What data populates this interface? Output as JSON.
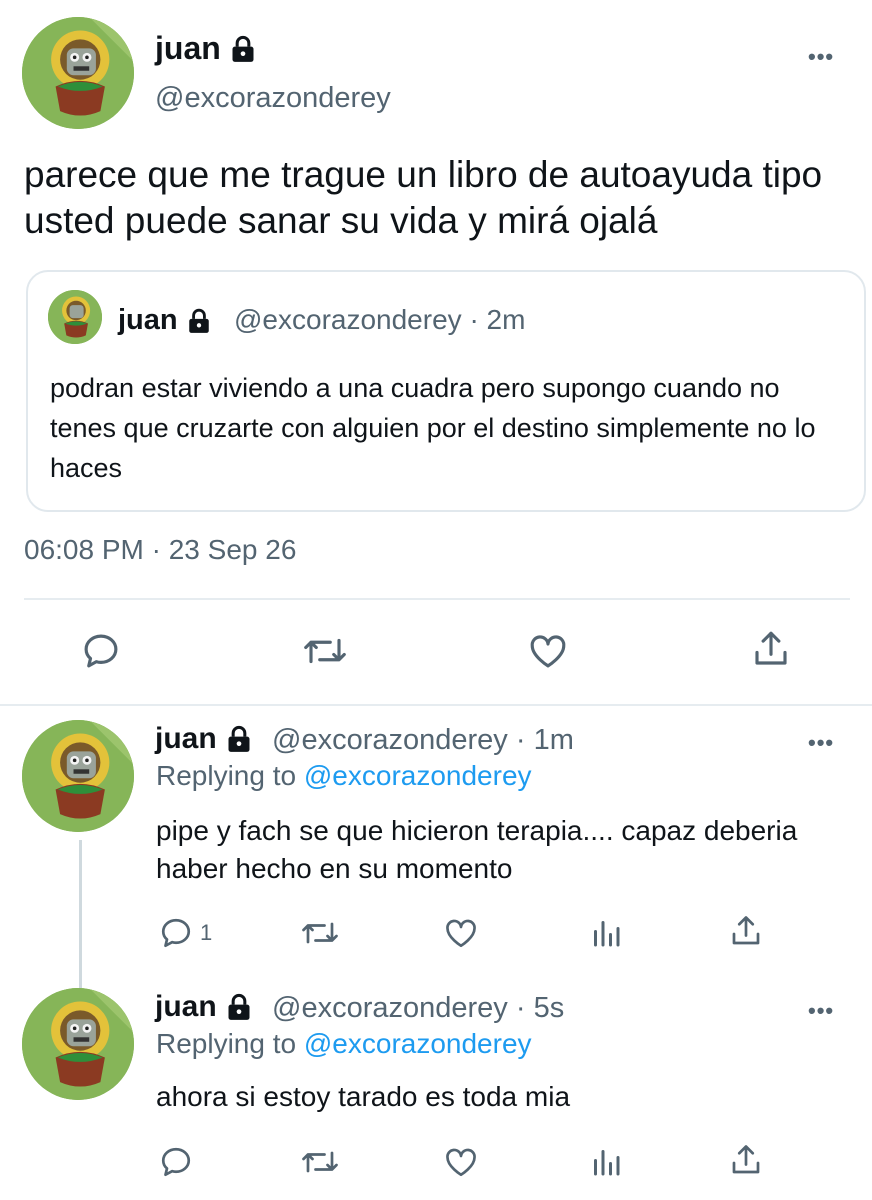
{
  "main_tweet": {
    "author_name": "juan",
    "handle": "@excorazonderey",
    "text": "parece que me trague un libro de autoayuda tipo usted puede sanar su vida y mirá ojalá",
    "quoted": {
      "author_name": "juan",
      "handle": "@excorazonderey",
      "time": "2m",
      "text": "podran estar viviendo a una cuadra pero supongo cuando no tenes que cruzarte con alguien por el destino simplemente no lo haces"
    },
    "timestamp": "06:08 PM · 23 Sep 26",
    "actions": [
      "reply-icon",
      "retweet-icon",
      "like-icon",
      "share-icon"
    ]
  },
  "replies": [
    {
      "author_name": "juan",
      "handle": "@excorazonderey",
      "time": "1m",
      "replying_label": "Replying to",
      "replying_to": "@excorazonderey",
      "text": "pipe y fach se que hicieron terapia.... capaz deberia haber hecho en su momento",
      "reply_count": "1"
    },
    {
      "author_name": "juan",
      "handle": "@excorazonderey",
      "time": "5s",
      "replying_label": "Replying to",
      "replying_to": "@excorazonderey",
      "text": "ahora si estoy tarado es toda mia",
      "reply_count": ""
    }
  ],
  "separator": "·",
  "more_label": "•••",
  "colors": {
    "text": "#0f1419",
    "secondary": "#536471",
    "link": "#1d9bf0",
    "border": "#e1e8ed"
  }
}
